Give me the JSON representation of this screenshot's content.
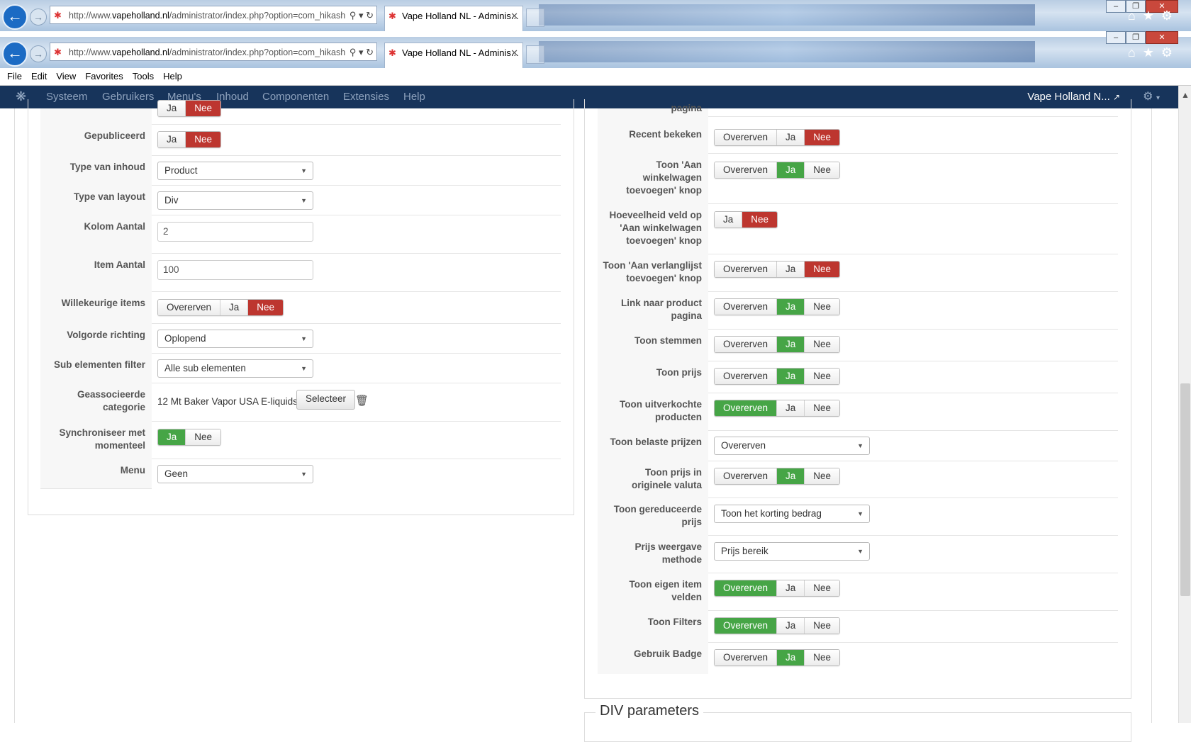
{
  "browser": {
    "url_prefix": "http://www.",
    "url_domain": "vapeholland.nl",
    "url_rest": "/administrator/index.php?option=com_hikash",
    "tab_title": "Vape Holland NL - Adminis...",
    "menu": [
      "File",
      "Edit",
      "View",
      "Favorites",
      "Tools",
      "Help"
    ]
  },
  "navbar": {
    "items": [
      "Systeem",
      "Gebruikers",
      "Menu's",
      "Inhoud",
      "Componenten",
      "Extensies",
      "Help"
    ],
    "site_name": "Vape Holland N..."
  },
  "left": {
    "partial_row": {
      "options": [
        "Ja",
        "Nee"
      ]
    },
    "rows": [
      {
        "label": "Gepubliceerd",
        "options": [
          "Ja",
          "Nee"
        ]
      },
      {
        "label": "Type van inhoud",
        "select": "Product"
      },
      {
        "label": "Type van layout",
        "select": "Div"
      },
      {
        "label": "Kolom Aantal",
        "input": "2"
      },
      {
        "label": "Item Aantal",
        "input": "100"
      },
      {
        "label": "Willekeurige items",
        "options": [
          "Overerven",
          "Ja",
          "Nee"
        ]
      },
      {
        "label": "Volgorde richting",
        "select": "Oplopend"
      },
      {
        "label": "Sub elementen filter",
        "select": "Alle sub elementen"
      },
      {
        "label": "Geassocieerde categorie",
        "text": "12 Mt Baker Vapor USA E-liquids",
        "button": "Selecteer"
      },
      {
        "label": "Synchroniseer met momenteel",
        "options": [
          "Ja",
          "Nee"
        ]
      },
      {
        "label": "Menu",
        "select": "Geen"
      }
    ]
  },
  "right": {
    "partial_label": "pagina",
    "rows": [
      {
        "label": "Recent bekeken",
        "options": [
          "Overerven",
          "Ja",
          "Nee"
        ]
      },
      {
        "label": "Toon 'Aan winkelwagen toevoegen' knop",
        "options": [
          "Overerven",
          "Ja",
          "Nee"
        ]
      },
      {
        "label": "Hoeveelheid veld op 'Aan winkelwagen toevoegen' knop",
        "options": [
          "Ja",
          "Nee"
        ]
      },
      {
        "label": "Toon 'Aan verlanglijst toevoegen' knop",
        "options": [
          "Overerven",
          "Ja",
          "Nee"
        ]
      },
      {
        "label": "Link naar product pagina",
        "options": [
          "Overerven",
          "Ja",
          "Nee"
        ]
      },
      {
        "label": "Toon stemmen",
        "options": [
          "Overerven",
          "Ja",
          "Nee"
        ]
      },
      {
        "label": "Toon prijs",
        "options": [
          "Overerven",
          "Ja",
          "Nee"
        ]
      },
      {
        "label": "Toon uitverkochte producten",
        "options": [
          "Overerven",
          "Ja",
          "Nee"
        ]
      },
      {
        "label": "Toon belaste prijzen",
        "select": "Overerven"
      },
      {
        "label": "Toon prijs in originele valuta",
        "options": [
          "Overerven",
          "Ja",
          "Nee"
        ]
      },
      {
        "label": "Toon gereduceerde prijs",
        "select": "Toon het korting bedrag"
      },
      {
        "label": "Prijs weergave methode",
        "select": "Prijs bereik"
      },
      {
        "label": "Toon eigen item velden",
        "options": [
          "Overerven",
          "Ja",
          "Nee"
        ]
      },
      {
        "label": "Toon Filters",
        "options": [
          "Overerven",
          "Ja",
          "Nee"
        ]
      },
      {
        "label": "Gebruik Badge",
        "options": [
          "Overerven",
          "Ja",
          "Nee"
        ]
      }
    ],
    "div_legend": "DIV parameters"
  },
  "colors": {
    "active_no": "#bd362f",
    "active_yes": "#46a546",
    "navbar": "#17345b"
  }
}
